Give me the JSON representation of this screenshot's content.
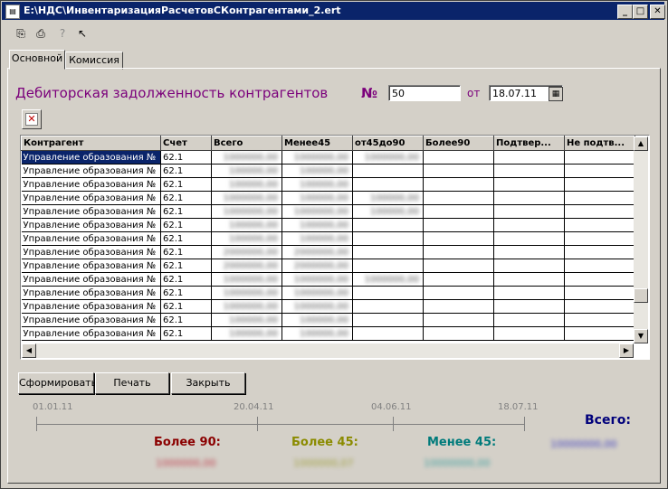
{
  "window": {
    "title": "E:\\НДС\\ИнвентаризацияРасчетовСКонтрагентами_2.ert"
  },
  "window_controls": {
    "minimize": "_",
    "maximize": "□",
    "close": "✕"
  },
  "toolbar": {
    "icons": [
      "open-icon",
      "save-icon",
      "help-icon",
      "pointer-help-icon"
    ]
  },
  "tabs": [
    {
      "label": "Основной",
      "active": true
    },
    {
      "label": "Комиссия",
      "active": false
    }
  ],
  "form": {
    "heading": "Дебиторская задолженность контрагентов",
    "number_label": "№",
    "number_value": "50",
    "date_label": "от",
    "date_value": "18.07.11"
  },
  "table": {
    "columns": [
      "Контрагент",
      "Счет",
      "Всего",
      "Менее45",
      "от45до90",
      "Более90",
      "Подтвер...",
      "Не подтв..."
    ],
    "rows": [
      [
        "Управление образования №",
        "62.1",
        "1000000,00",
        "1000000,00",
        "1000000,00",
        "",
        "",
        ""
      ],
      [
        "Управление образования №",
        "62.1",
        "100000,00",
        "100000,00",
        "",
        "",
        "",
        ""
      ],
      [
        "Управление образования №",
        "62.1",
        "100000,00",
        "100000,00",
        "",
        "",
        "",
        ""
      ],
      [
        "Управление образования №",
        "62.1",
        "1000000,00",
        "100000,00",
        "100000,00",
        "",
        "",
        ""
      ],
      [
        "Управление образования №",
        "62.1",
        "1000000,00",
        "1000000,00",
        "100000,00",
        "",
        "",
        ""
      ],
      [
        "Управление образования №",
        "62.1",
        "100000,00",
        "100000,00",
        "",
        "",
        "",
        ""
      ],
      [
        "Управление образования №",
        "62.1",
        "100000,00",
        "100000,00",
        "",
        "",
        "",
        ""
      ],
      [
        "Управление образования №",
        "62.1",
        "2000000,00",
        "2000000,00",
        "",
        "",
        "",
        ""
      ],
      [
        "Управление образования №",
        "62.1",
        "2000000,00",
        "2000000,00",
        "",
        "",
        "",
        ""
      ],
      [
        "Управление образования №",
        "62.1",
        "1000000,00",
        "1000000,00",
        "1000000,00",
        "",
        "",
        ""
      ],
      [
        "Управление образования №",
        "62.1",
        "1000000,00",
        "1000000,00",
        "",
        "",
        "",
        ""
      ],
      [
        "Управление образования №",
        "62.1",
        "1000000,00",
        "1000000,00",
        "",
        "",
        "",
        ""
      ],
      [
        "Управление образования №",
        "62.1",
        "100000,00",
        "100000,00",
        "",
        "",
        "",
        ""
      ],
      [
        "Управление образования №",
        "62.1",
        "100000,00",
        "100000,00",
        "",
        "",
        "",
        ""
      ]
    ]
  },
  "buttons": {
    "generate": "Сформировать",
    "print": "Печать",
    "close": "Закрыть"
  },
  "timeline": {
    "dates": [
      "01.01.11",
      "20.04.11",
      "04.06.11",
      "18.07.11"
    ]
  },
  "summary": {
    "over90_label": "Более 90:",
    "over90_value": "1000000,00",
    "over45_label": "Более 45:",
    "over45_value": "1000000,07",
    "under45_label": "Менее 45:",
    "under45_value": "10000000,00",
    "total_label": "Всего:",
    "total_value": "10000000,00"
  },
  "colors": {
    "heading": "#7b007b",
    "over90": "#8b0000",
    "over45": "#8b8b00",
    "under45": "#007b7b",
    "total": "#00007b"
  }
}
